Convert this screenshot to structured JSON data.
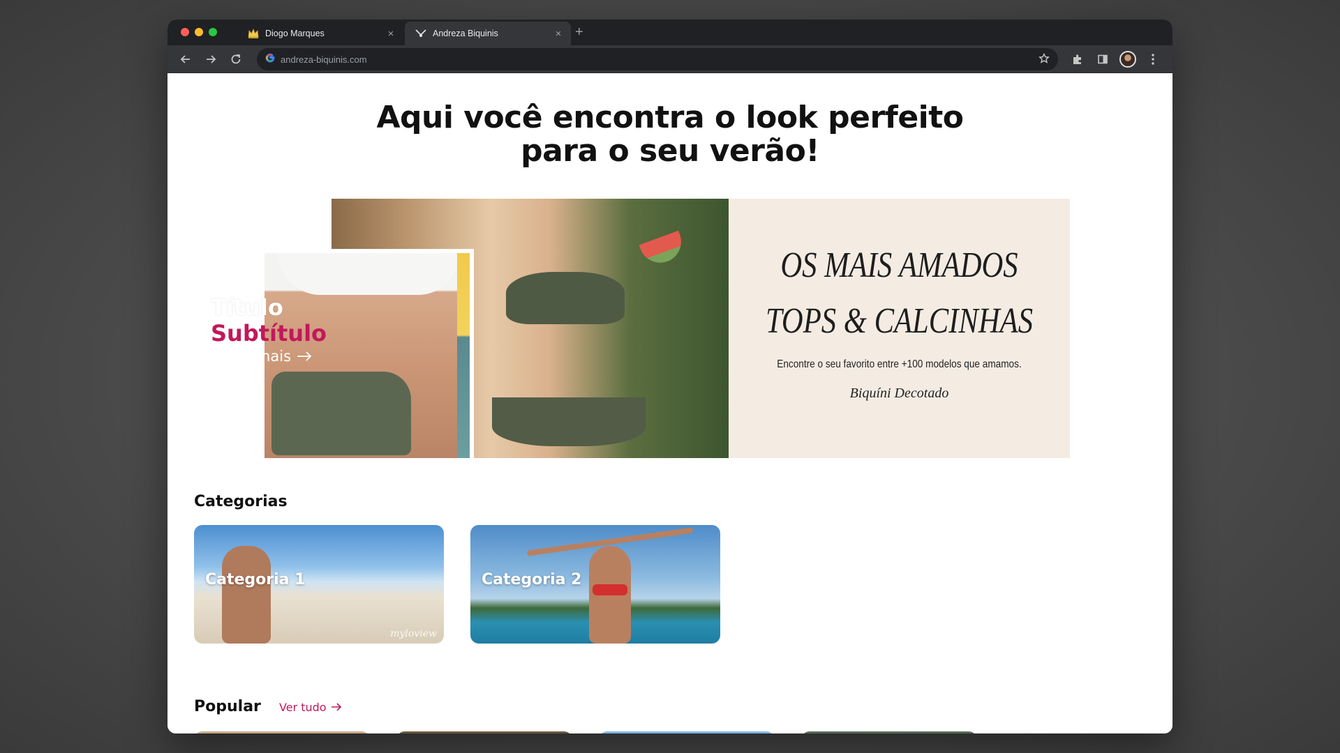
{
  "browser": {
    "tabs": [
      {
        "title": "Diogo Marques",
        "active": false,
        "favicon": "crown-icon"
      },
      {
        "title": "Andreza Biquinis",
        "active": true,
        "favicon": "bikini-logo-icon"
      }
    ],
    "url": "andreza-biquinis.com"
  },
  "hero": {
    "title_line1": "Aqui você encontra o look perfeito",
    "title_line2": "para o seu verão!"
  },
  "banner": {
    "line1": "OS MAIS AMADOS",
    "line2": "TOPS & CALCINHAS",
    "small": "Encontre o seu favorito entre +100 modelos que amamos.",
    "sub": "Biquíni Decotado",
    "overlay_title": "Título",
    "overlay_subtitle": "Subtítulo",
    "overlay_link": "Saiba mais"
  },
  "categories": {
    "title": "Categorias",
    "items": [
      {
        "label": "Categoria 1",
        "watermark": "myloview"
      },
      {
        "label": "Categoria 2"
      }
    ]
  },
  "popular": {
    "title": "Popular",
    "link": "Ver tudo"
  },
  "colors": {
    "accent": "#c2185b",
    "banner_panel": "#f4ece3",
    "chrome_dark": "#202124"
  }
}
